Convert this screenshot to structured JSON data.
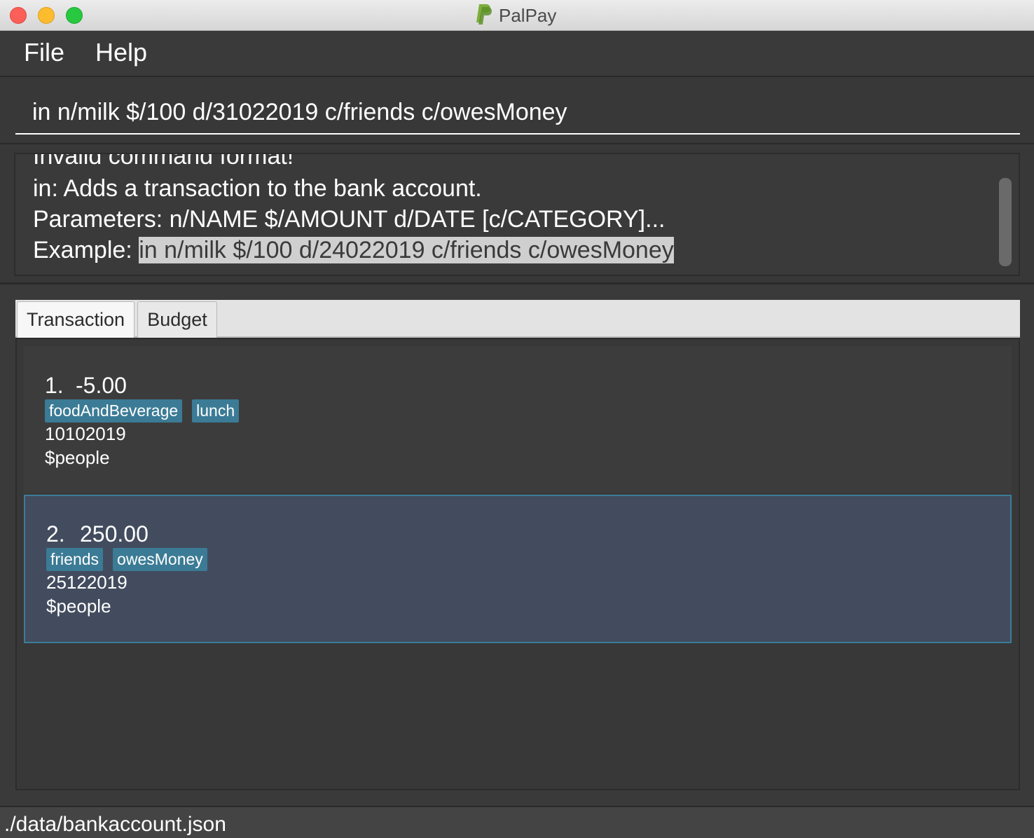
{
  "window": {
    "title": "PalPay"
  },
  "menu": {
    "file_label": "File",
    "help_label": "Help"
  },
  "command": {
    "value": "in n/milk $/100 d/31022019 c/friends c/owesMoney"
  },
  "result": {
    "line0": "Invalid command format!",
    "line1": "in: Adds a transaction to the bank account.",
    "line2": "Parameters: n/NAME $/AMOUNT d/DATE [c/CATEGORY]...",
    "line3_prefix": "Example: ",
    "line3_example": "in n/milk $/100 d/24022019 c/friends c/owesMoney"
  },
  "tabs": [
    {
      "label": "Transaction",
      "selected": true
    },
    {
      "label": "Budget",
      "selected": false
    }
  ],
  "transactions": [
    {
      "index": "1.",
      "amount": "-5.00",
      "tags": [
        "foodAndBeverage",
        "lunch"
      ],
      "date": "10102019",
      "peopleline": "$people"
    },
    {
      "index": "2.",
      "amount": "250.00",
      "tags": [
        "friends",
        "owesMoney"
      ],
      "date": "25122019",
      "peopleline": "$people"
    }
  ],
  "status": {
    "path": "./data/bankaccount.json"
  },
  "colors": {
    "background": "#3a3a3a",
    "tag": "#3b7b95",
    "selected_card": "#424c5e",
    "selected_border": "#3b7c99"
  }
}
